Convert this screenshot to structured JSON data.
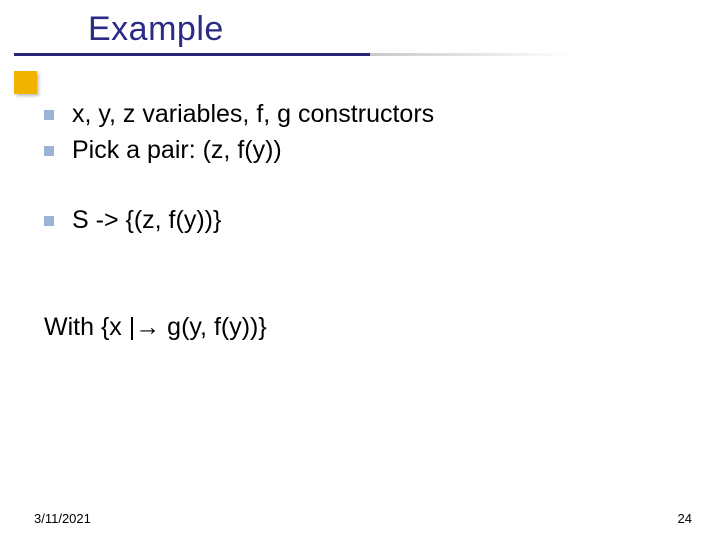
{
  "title": "Example",
  "bullets_group1": [
    "x, y, z variables, f, g constructors",
    "Pick a pair: (z, f(y))"
  ],
  "bullets_group2": [
    "S -> {(z, f(y))}"
  ],
  "with_line": "With {x |→ g(y, f(y))}",
  "footer": {
    "date": "3/11/2021",
    "page": "24"
  }
}
